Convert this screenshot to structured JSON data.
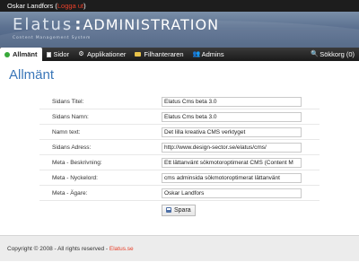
{
  "userbar": {
    "username": "Oskar Landfors",
    "logout_label": "Logga ut"
  },
  "header": {
    "logo_name": "Elatus",
    "logo_separator": ":",
    "logo_section": "ADMINISTRATION",
    "logo_tagline": "Content Management System"
  },
  "nav": {
    "items": [
      {
        "label": "Allmänt",
        "icon": "green-dot-icon",
        "active": true
      },
      {
        "label": "Sidor",
        "icon": "page-icon"
      },
      {
        "label": "Applikationer",
        "icon": "gear-icon"
      },
      {
        "label": "Filhanteraren",
        "icon": "folder-icon"
      },
      {
        "label": "Admins",
        "icon": "users-icon"
      }
    ],
    "search_basket_label": "Sökkorg (0)"
  },
  "main": {
    "title": "Allmänt",
    "fields": [
      {
        "label": "Sidans Titel:",
        "value": "Elatus Cms beta 3.0"
      },
      {
        "label": "Sidans Namn:",
        "value": "Elatus Cms beta 3.0"
      },
      {
        "label": "Namn text:",
        "value": "Det lilla kreativa CMS verktyget"
      },
      {
        "label": "Sidans Adress:",
        "value": "http://www.design-sector.se/elatus/cms/"
      },
      {
        "label": "Meta - Beskrivning:",
        "value": "Ett lättanvänt sökmotoroptimerat CMS (Content M"
      },
      {
        "label": "Meta - Nyckelord:",
        "value": "cms adminsida sökmotoroptimerat lättanvänt"
      },
      {
        "label": "Meta - Ägare:",
        "value": "Oskar Landfors"
      }
    ],
    "save_label": "Spara"
  },
  "footer": {
    "copyright": "Copyright © 2008 - All rights reserved -",
    "link": "Elatus.se"
  },
  "colors": {
    "accent_blue": "#3a76b8",
    "link_red": "#e8402a",
    "nav_dark": "#1a1a1a"
  }
}
